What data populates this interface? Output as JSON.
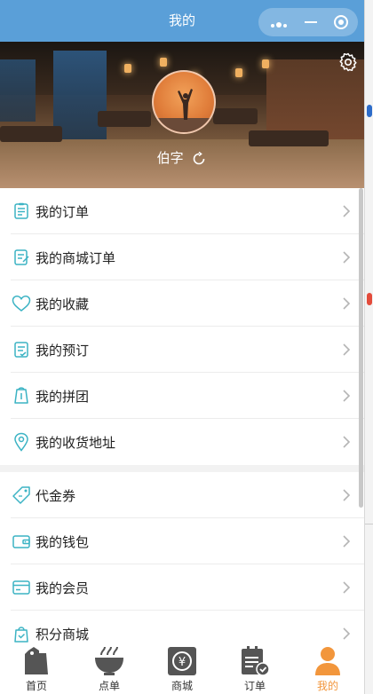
{
  "titlebar": {
    "title": "我的"
  },
  "profile": {
    "username": "伯字"
  },
  "menu_group_1": [
    {
      "label": "我的订单",
      "icon": "order-list-icon"
    },
    {
      "label": "我的商城订单",
      "icon": "mall-order-icon"
    },
    {
      "label": "我的收藏",
      "icon": "heart-icon"
    },
    {
      "label": "我的预订",
      "icon": "reservation-icon"
    },
    {
      "label": "我的拼团",
      "icon": "group-buy-icon"
    },
    {
      "label": "我的收货地址",
      "icon": "location-pin-icon"
    }
  ],
  "menu_group_2": [
    {
      "label": "代金券",
      "icon": "coupon-icon"
    },
    {
      "label": "我的钱包",
      "icon": "wallet-icon"
    },
    {
      "label": "我的会员",
      "icon": "membership-card-icon"
    },
    {
      "label": "积分商城",
      "icon": "points-mall-icon"
    }
  ],
  "tabs": [
    {
      "label": "首页",
      "icon": "home-tag-icon"
    },
    {
      "label": "点单",
      "icon": "bowl-icon"
    },
    {
      "label": "商城",
      "icon": "mall-yuan-icon"
    },
    {
      "label": "订单",
      "icon": "order-clipboard-icon"
    },
    {
      "label": "我的",
      "icon": "person-icon",
      "active": true
    }
  ],
  "colors": {
    "titlebar": "#5a9fd8",
    "accent_icon": "#3bb3c4",
    "tab_active": "#f2963c",
    "tab_icon": "#555555"
  }
}
